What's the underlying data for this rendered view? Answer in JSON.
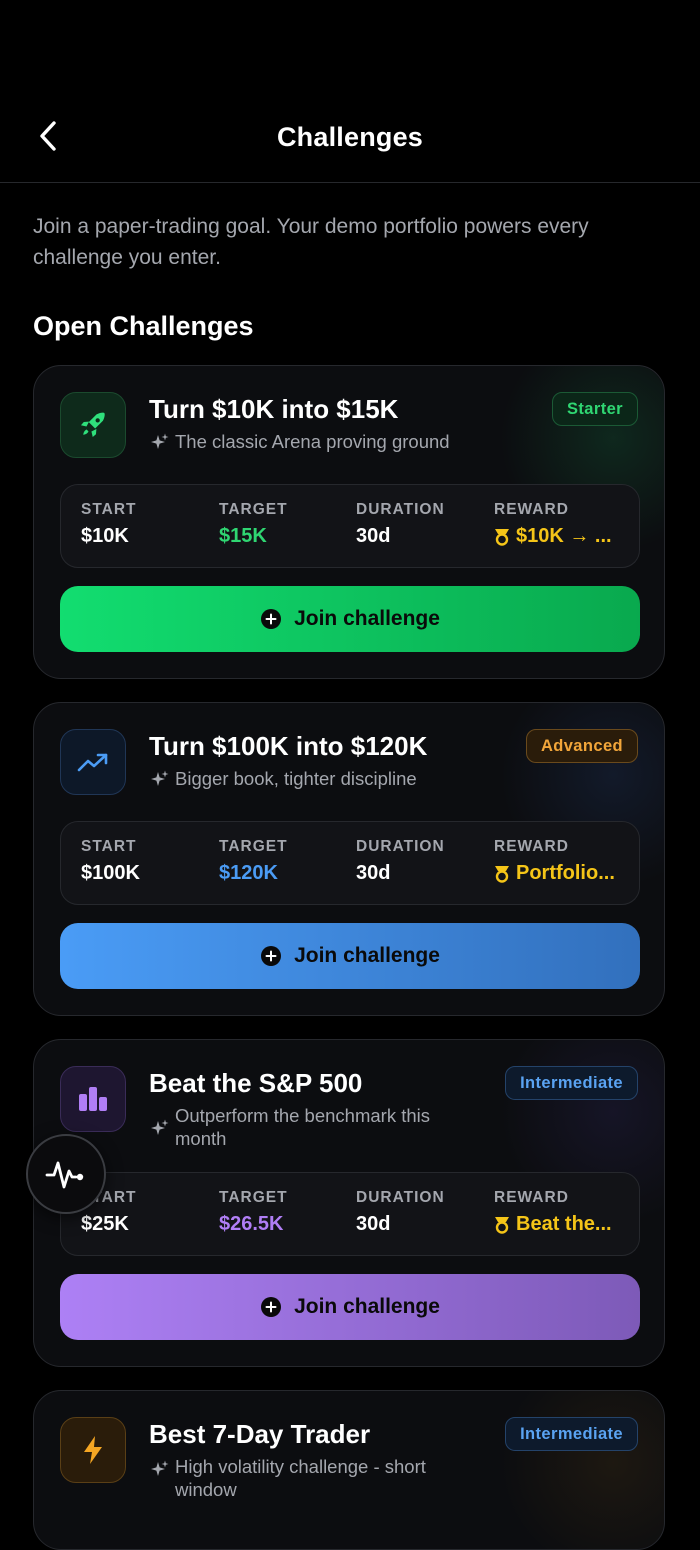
{
  "header": {
    "title": "Challenges"
  },
  "intro": "Join a paper-trading goal. Your demo portfolio powers every challenge you enter.",
  "section_title": "Open Challenges",
  "stat_labels": {
    "start": "START",
    "target": "TARGET",
    "duration": "DURATION",
    "reward": "REWARD"
  },
  "cards": [
    {
      "title": "Turn $10K into $15K",
      "subtitle": "The classic Arena proving ground",
      "badge": "Starter",
      "icon": "rocket-icon",
      "accent": "#1fd16a",
      "start": "$10K",
      "target": "$15K",
      "duration": "30d",
      "reward": "$10K → ...",
      "button": "Join challenge"
    },
    {
      "title": "Turn $100K into $120K",
      "subtitle": "Bigger book, tighter discipline",
      "badge": "Advanced",
      "icon": "trending-up-icon",
      "accent": "#4b9cf5",
      "start": "$100K",
      "target": "$120K",
      "duration": "30d",
      "reward": "Portfolio...",
      "button": "Join challenge"
    },
    {
      "title": "Beat the S&P 500",
      "subtitle": "Outperform the benchmark this month",
      "badge": "Intermediate",
      "icon": "bar-chart-icon",
      "accent": "#b07ef5",
      "start": "$25K",
      "target": "$26.5K",
      "duration": "30d",
      "reward": "Beat the...",
      "button": "Join challenge"
    },
    {
      "title": "Best 7-Day Trader",
      "subtitle": "High volatility challenge - short window",
      "badge": "Intermediate",
      "icon": "lightning-icon",
      "accent": "#f5a623"
    }
  ],
  "fab_icon": "activity-pulse-icon"
}
